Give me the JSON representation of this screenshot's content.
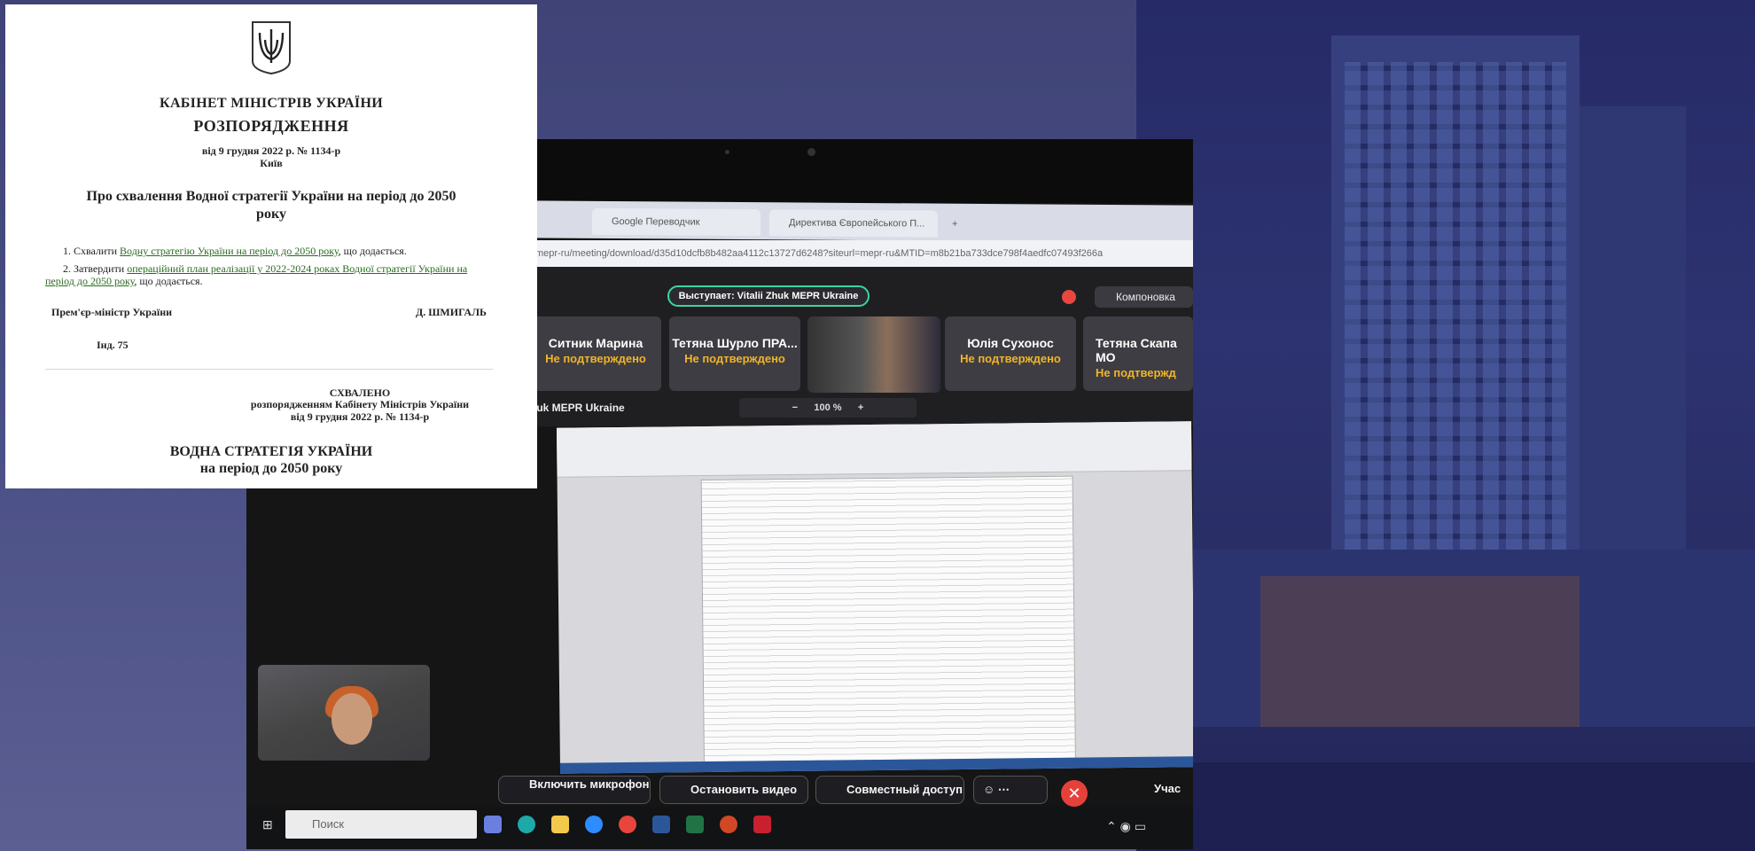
{
  "document": {
    "heading_cabinet": "КАБІНЕТ МІНІСТРІВ УКРАЇНИ",
    "heading_order": "РОЗПОРЯДЖЕННЯ",
    "date_number": "від 9 грудня 2022 р. № 1134-р",
    "city": "Київ",
    "title": "Про схвалення Водної стратегії України на період до 2050 року",
    "item1_prefix": "1. Схвалити ",
    "item1_link": "Водну стратегію України на період до 2050 року",
    "item1_suffix": ", що додається.",
    "item2_prefix": "2. Затвердити ",
    "item2_link": "операційний план реалізації у 2022-2024 роках Водної стратегії України на період до 2050 року",
    "item2_suffix": ", що додається.",
    "signer_position": "Прем'єр-міністр України",
    "signer_name": "Д. ШМИГАЛЬ",
    "index": "Інд. 75",
    "approved": "СХВАЛЕНО",
    "approved_by": "розпорядженням Кабінету Міністрів України",
    "approved_date": "від 9 грудня 2022 р. № 1134-р",
    "strategy_title": "ВОДНА СТРАТЕГІЯ УКРАЇНИ",
    "strategy_period": "на період до 2050 року"
  },
  "browser": {
    "tab1": "Google Переводчик",
    "tab2": "Директива Європейського П...",
    "address": "mepr-ru/meeting/download/d35d10dcfb8b482aa4112c13727d6248?siteurl=mepr-ru&MTID=m8b21ba733dce798f4aedfc07493f266a"
  },
  "meeting": {
    "speaker": "Выступает: Vitalii Zhuk MEPR Ukraine",
    "layout_button": "Компоновка",
    "participants": [
      {
        "name": "Ситник Марина",
        "status": "Не подтверждено"
      },
      {
        "name": "Тетяна Шурло ПРА...",
        "status": "Не подтверждено"
      },
      {
        "name": "Юлія Сухонос",
        "status": "Не подтверждено"
      },
      {
        "name": "Тетяна Скапа МО",
        "status": "Не подтвержд"
      }
    ],
    "presenter_strip": "huk MEPR Ukraine",
    "zoom": "100 %",
    "controls": {
      "mic": "Включить микрофон",
      "video": "Остановить видео",
      "share": "Совместный доступ",
      "participants": "Учас"
    }
  },
  "taskbar": {
    "search_placeholder": "Поиск"
  }
}
